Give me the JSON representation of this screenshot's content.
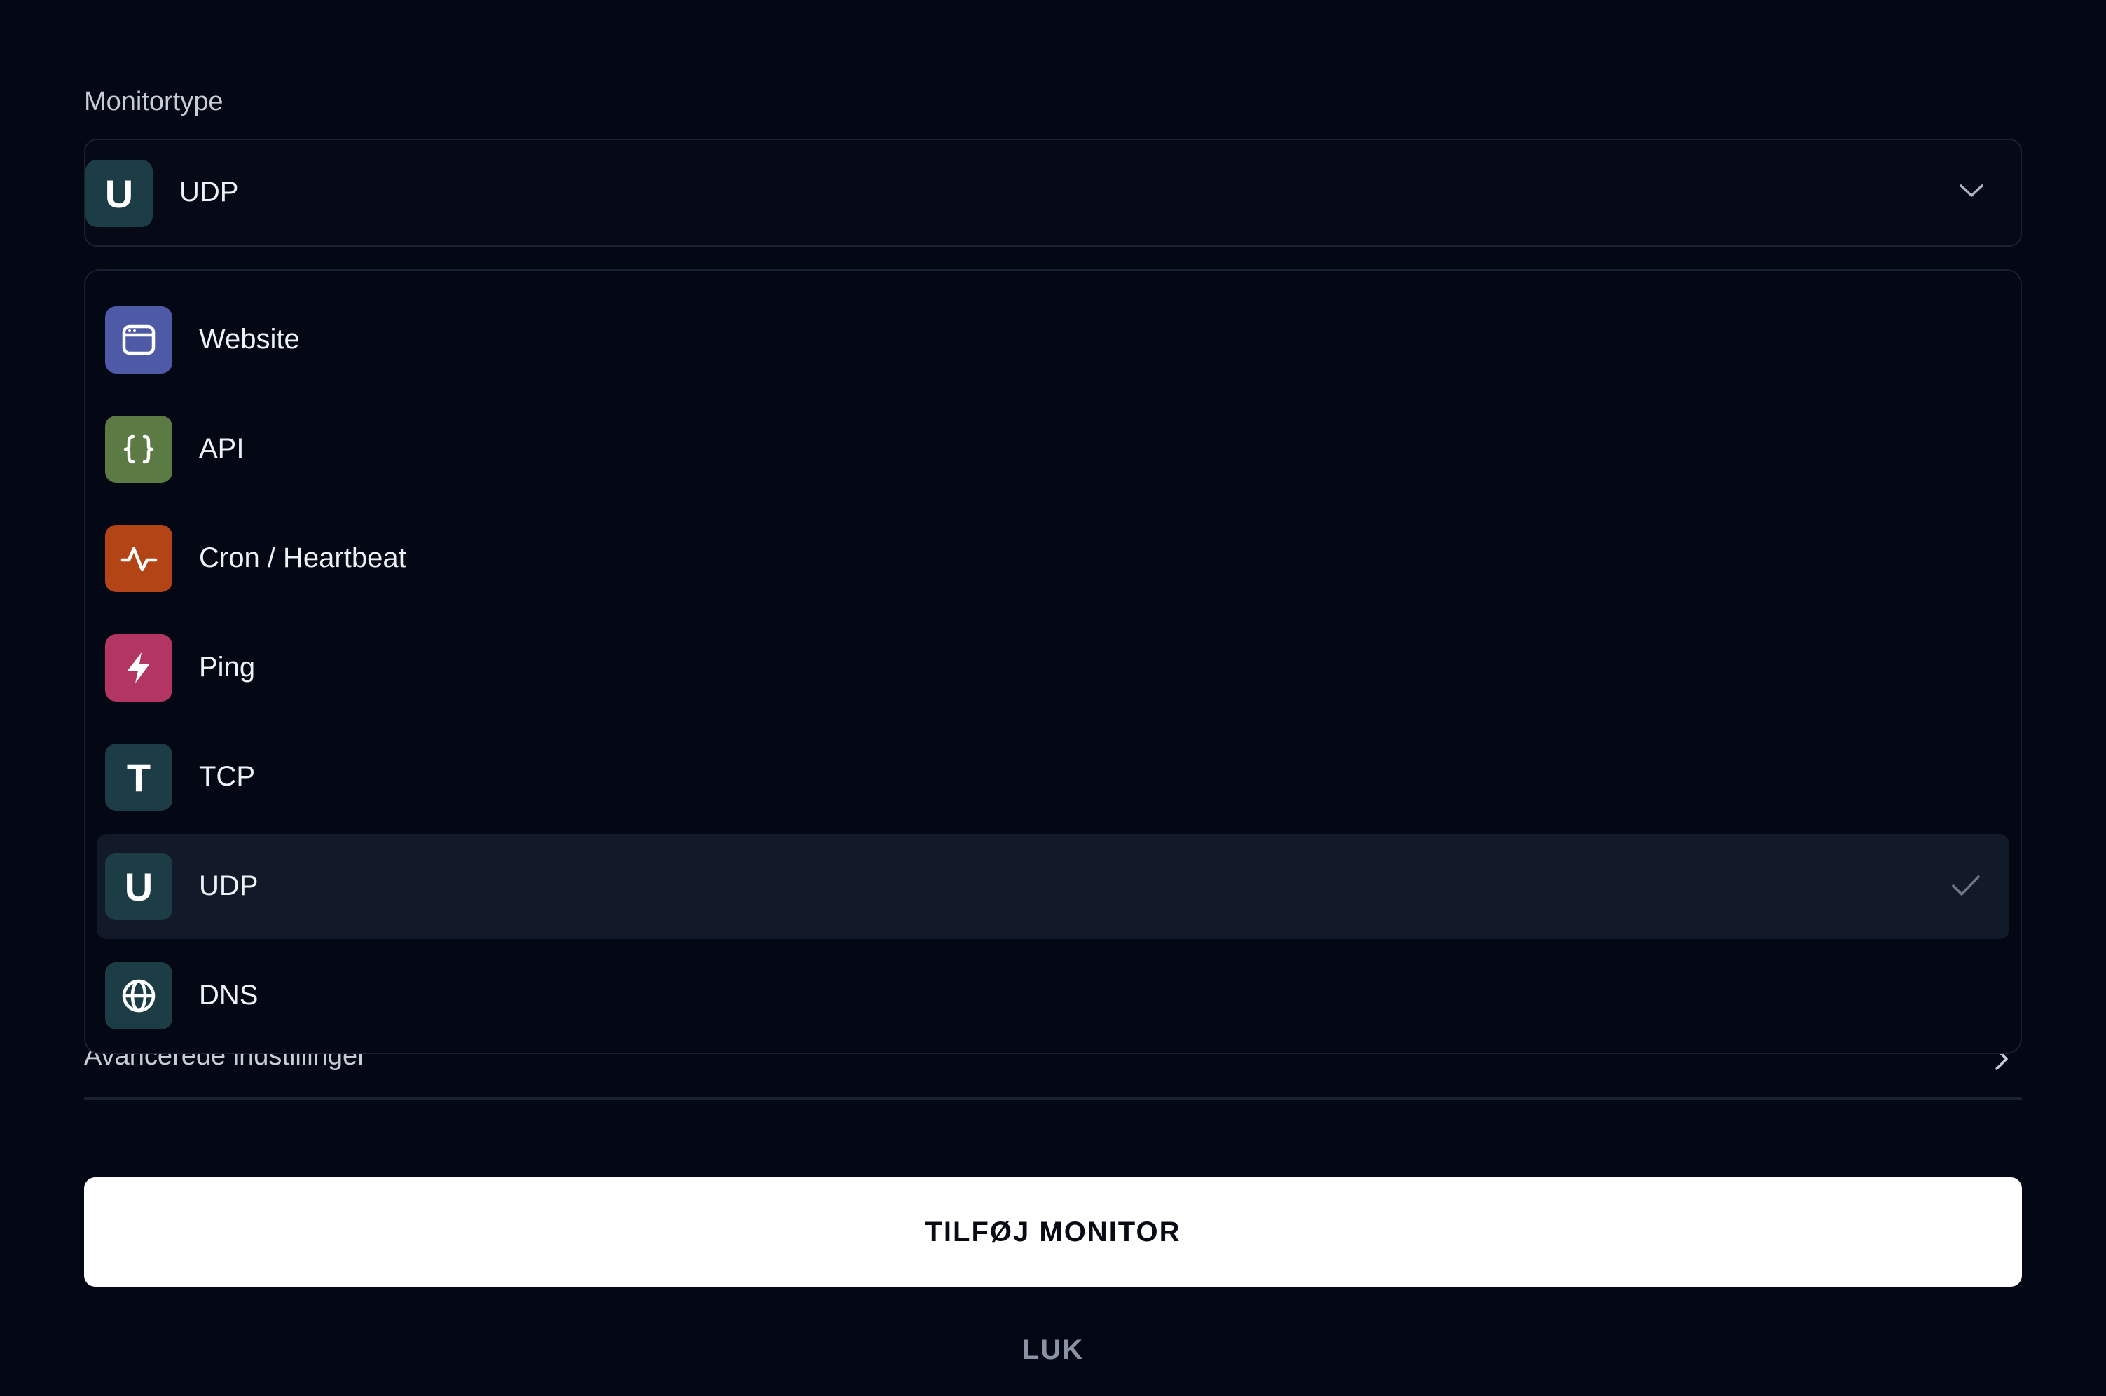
{
  "form": {
    "monitor_type_label": "Monitortype",
    "selected_value": "UDP",
    "selected_badge_letter": "U",
    "advanced_settings_label": "Avancerede indstillinger"
  },
  "dropdown": {
    "options": [
      {
        "label": "Website",
        "icon": "browser-window-icon",
        "color": "#4e5aa6"
      },
      {
        "label": "API",
        "icon": "curly-braces-icon",
        "color": "#5c7a43"
      },
      {
        "label": "Cron / Heartbeat",
        "icon": "activity-pulse-icon",
        "color": "#b24416"
      },
      {
        "label": "Ping",
        "icon": "lightning-bolt-icon",
        "color": "#b33562"
      },
      {
        "label": "TCP",
        "icon": "letter-t-icon",
        "letter": "T",
        "color": "#1d3d46"
      },
      {
        "label": "UDP",
        "icon": "letter-u-icon",
        "letter": "U",
        "color": "#1d3d46",
        "selected": true
      },
      {
        "label": "DNS",
        "icon": "globe-icon",
        "color": "#1d3d46"
      }
    ]
  },
  "actions": {
    "add_monitor": "TILFØJ MONITOR",
    "close": "LUK"
  },
  "colors": {
    "background": "#040814",
    "selected_row": "#121a2a",
    "border": "#1a2130",
    "primary_button": "#ffffff"
  }
}
